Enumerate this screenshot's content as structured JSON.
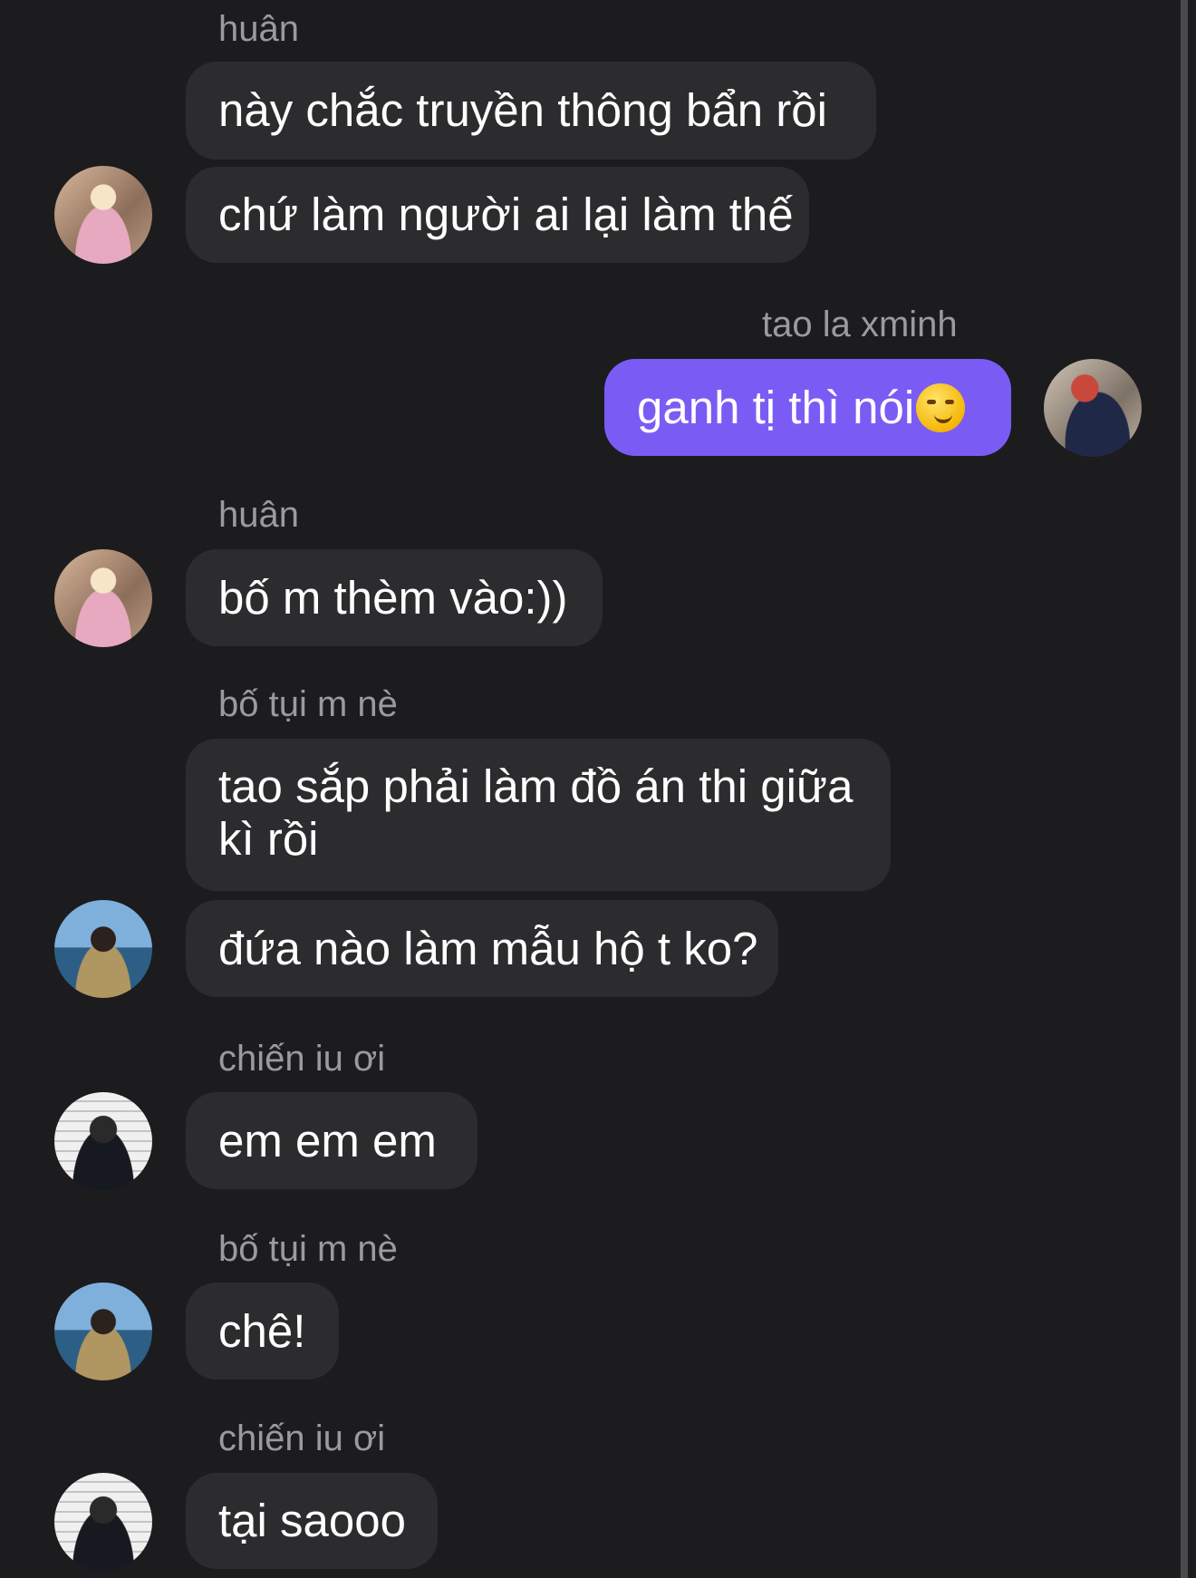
{
  "messages": [
    {
      "sender": "huân",
      "lines": [
        "này chắc truyền thông bẩn rồi",
        "chứ làm người ai lại làm thế"
      ]
    },
    {
      "sender": "tao la xminh",
      "lines": [
        "ganh tị thì nói"
      ],
      "emoji": "smirking-face"
    },
    {
      "sender": "huân",
      "lines": [
        "bố m thèm vào:))"
      ]
    },
    {
      "sender": "bố tụi m nè",
      "lines": [
        "tao sắp phải làm đồ án thi giữa kì rồi",
        "đứa nào làm mẫu hộ t ko?"
      ]
    },
    {
      "sender": "chiến iu ơi",
      "lines": [
        "em em em"
      ]
    },
    {
      "sender": "bố tụi m nè",
      "lines": [
        "chê!"
      ]
    },
    {
      "sender": "chiến iu ơi",
      "lines": [
        "tại saooo"
      ]
    }
  ],
  "colors": {
    "background": "#1c1c1e",
    "incoming_bubble": "#2c2c2e",
    "outgoing_bubble": "#7a5cf5",
    "sender_name": "#9a9a9f"
  }
}
